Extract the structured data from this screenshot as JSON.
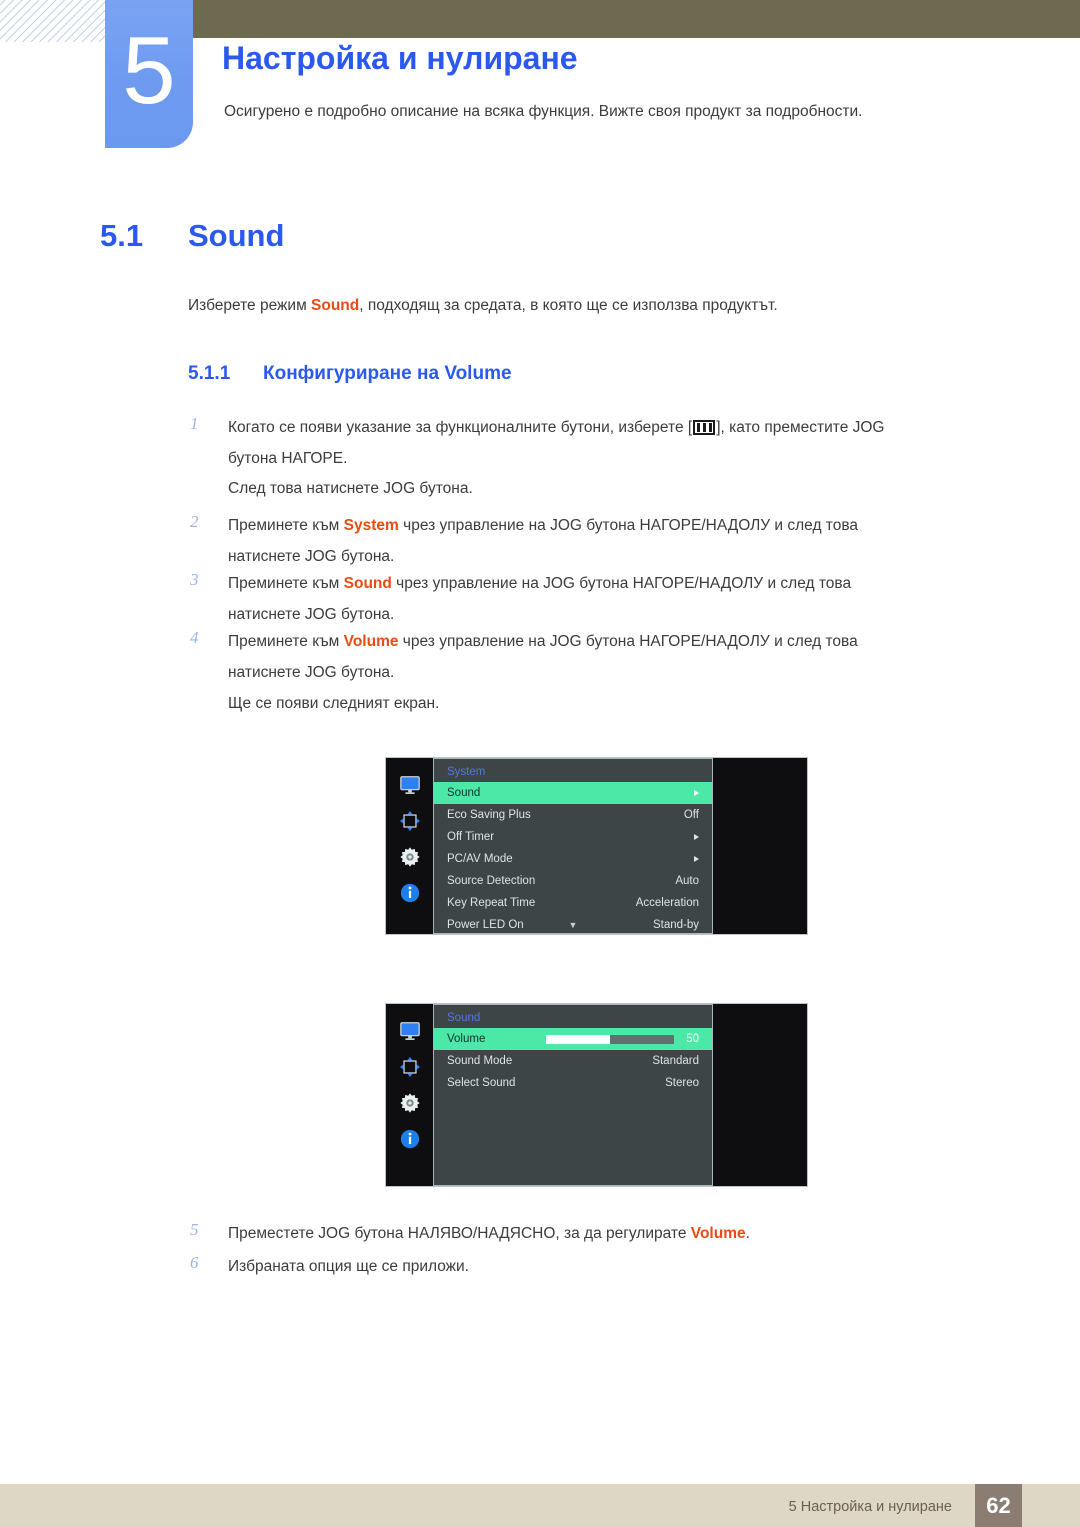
{
  "header": {
    "chapter_number": "5",
    "chapter_title": "Настройка и нулиране",
    "chapter_subtitle": "Осигурено е подробно описание на всяка функция. Вижте своя продукт за подробности."
  },
  "section": {
    "number": "5.1",
    "title": "Sound",
    "intro_before": "Изберете режим ",
    "intro_highlight": "Sound",
    "intro_after": ", подходящ за средата, в която ще се използва продуктът."
  },
  "subsection": {
    "number": "5.1.1",
    "title": "Конфигуриране на Volume"
  },
  "steps": [
    {
      "num": "1",
      "line1_before": "Когато се появи указание за функционалните бутони, изберете [",
      "icon": "jog-menu-icon",
      "line1_after": "], като преместите JOG",
      "line2": "бутона НАГОРЕ.",
      "note": "След това натиснете JOG бутона."
    },
    {
      "num": "2",
      "line1_before": "Преминете към ",
      "highlight": "System",
      "line1_after": " чрез управление на JOG бутона НАГОРЕ/НАДОЛУ и след това",
      "line2": "натиснете JOG бутона."
    },
    {
      "num": "3",
      "line1_before": "Преминете към ",
      "highlight": "Sound",
      "line1_after": " чрез управление на JOG бутона НАГОРЕ/НАДОЛУ и след това",
      "line2": "натиснете JOG бутона."
    },
    {
      "num": "4",
      "line1_before": "Преминете към ",
      "highlight": "Volume",
      "line1_after": " чрез управление на JOG бутона НАГОРЕ/НАДОЛУ и след това",
      "line2": "натиснете JOG бутона.",
      "note": "Ще се появи следният екран."
    },
    {
      "num": "5",
      "line1_before": "Преместете JOG бутона НАЛЯВО/НАДЯСНО, за да регулирате ",
      "highlight": "Volume",
      "line1_after": "."
    },
    {
      "num": "6",
      "line1_before": "Избраната опция ще се приложи."
    }
  ],
  "osd_system": {
    "title": "System",
    "sidebar_icons": [
      "monitor-icon",
      "move-arrows-icon",
      "gear-icon",
      "info-icon"
    ],
    "rows": [
      {
        "label": "Sound",
        "value": "",
        "arrow": true,
        "selected": true
      },
      {
        "label": "Eco Saving Plus",
        "value": "Off",
        "arrow": false,
        "selected": false
      },
      {
        "label": "Off Timer",
        "value": "",
        "arrow": true,
        "selected": false
      },
      {
        "label": "PC/AV Mode",
        "value": "",
        "arrow": true,
        "selected": false
      },
      {
        "label": "Source Detection",
        "value": "Auto",
        "arrow": false,
        "selected": false
      },
      {
        "label": "Key Repeat Time",
        "value": "Acceleration",
        "arrow": false,
        "selected": false
      },
      {
        "label": "Power LED On",
        "value": "Stand-by",
        "arrow": false,
        "selected": false
      }
    ],
    "more_glyph": "▼"
  },
  "osd_sound": {
    "title": "Sound",
    "sidebar_icons": [
      "monitor-icon",
      "move-arrows-icon",
      "gear-icon",
      "info-icon"
    ],
    "rows": [
      {
        "label": "Volume",
        "value": "50",
        "slider": 50,
        "selected": true
      },
      {
        "label": "Sound Mode",
        "value": "Standard",
        "selected": false
      },
      {
        "label": "Select Sound",
        "value": "Stereo",
        "selected": false
      }
    ]
  },
  "footer": {
    "text": "5 Настройка и нулиране",
    "page": "62"
  },
  "colors": {
    "accent_blue": "#2b59f0",
    "tab_blue": "#7ba3f2",
    "olive": "#6e6a52",
    "orange": "#e84c12",
    "osd_highlight": "#4be8a8",
    "footer_bar": "#ded7c6",
    "footer_page": "#8b7d72"
  }
}
